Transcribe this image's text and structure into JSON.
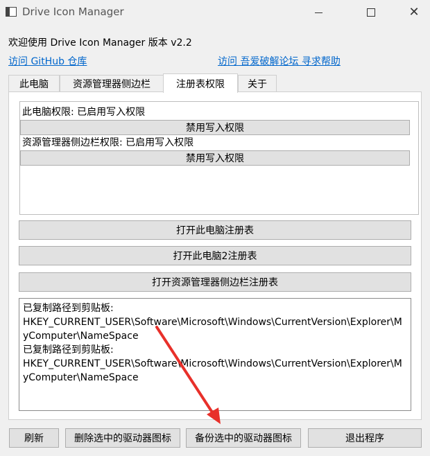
{
  "window": {
    "title": "Drive Icon Manager",
    "controls": {
      "minimize": "minimize-icon",
      "maximize": "maximize-icon",
      "close": "close-icon"
    }
  },
  "header": {
    "welcome": "欢迎使用 Drive Icon Manager 版本 v2.2",
    "github_link": "访问 GitHub 仓库",
    "forum_link": "访问 吾爱破解论坛 寻求帮助"
  },
  "tabs": [
    {
      "label": "此电脑"
    },
    {
      "label": "资源管理器侧边栏"
    },
    {
      "label": "注册表权限"
    },
    {
      "label": "关于"
    }
  ],
  "permissions": {
    "pc_label": "此电脑权限: 已启用写入权限",
    "pc_button": "禁用写入权限",
    "sidebar_label": "资源管理器侧边栏权限: 已启用写入权限",
    "sidebar_button": "禁用写入权限"
  },
  "actions": {
    "open_pc": "打开此电脑注册表",
    "open_pc2": "打开此电脑2注册表",
    "open_sidebar": "打开资源管理器侧边栏注册表"
  },
  "log": {
    "text": "已复制路径到剪贴板:\nHKEY_CURRENT_USER\\Software\\Microsoft\\Windows\\CurrentVersion\\Explorer\\MyComputer\\NameSpace\n已复制路径到剪贴板:\nHKEY_CURRENT_USER\\Software\\Microsoft\\Windows\\CurrentVersion\\Explorer\\MyComputer\\NameSpace"
  },
  "footer": {
    "refresh": "刷新",
    "delete": "删除选中的驱动器图标",
    "backup": "备份选中的驱动器图标",
    "exit": "退出程序"
  },
  "colors": {
    "link": "#0066cc",
    "arrow": "#e8302a",
    "button_bg": "#e1e1e1"
  }
}
